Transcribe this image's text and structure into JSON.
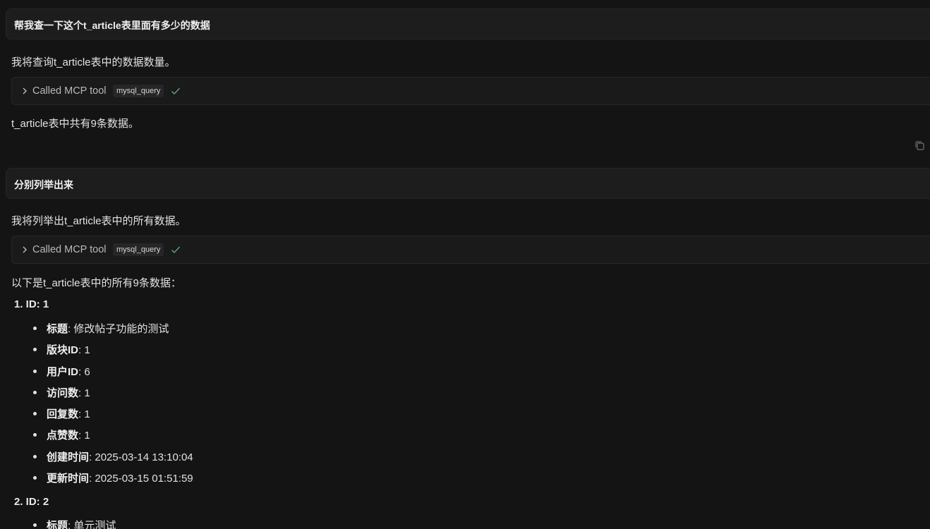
{
  "conversation": {
    "turn1": {
      "user": "帮我查一下这个t_article表里面有多少的数据",
      "assistant_intro": "我将查询t_article表中的数据数量。",
      "tool_call": {
        "label": "Called MCP tool",
        "tool_name": "mysql_query",
        "status": "success"
      },
      "assistant_result": "t_article表中共有9条数据。"
    },
    "turn2": {
      "user": "分别列举出来",
      "assistant_intro": "我将列举出t_article表中的所有数据。",
      "tool_call": {
        "label": "Called MCP tool",
        "tool_name": "mysql_query",
        "status": "success"
      },
      "assistant_result": "以下是t_article表中的所有9条数据："
    }
  },
  "records": [
    {
      "heading": "1. ID: 1",
      "fields": [
        {
          "key": "标题",
          "value": ": 修改帖子功能的测试"
        },
        {
          "key": "版块ID",
          "value": ": 1"
        },
        {
          "key": "用户ID",
          "value": ": 6"
        },
        {
          "key": "访问数",
          "value": ": 1"
        },
        {
          "key": "回复数",
          "value": ": 1"
        },
        {
          "key": "点赞数",
          "value": ": 1"
        },
        {
          "key": "创建时间",
          "value": ": 2025-03-14 13:10:04"
        },
        {
          "key": "更新时间",
          "value": ": 2025-03-15 01:51:59"
        }
      ]
    },
    {
      "heading": "2. ID: 2",
      "fields": [
        {
          "key": "标题",
          "value": ": 单元测试"
        }
      ]
    }
  ],
  "icons": {
    "chevron": "chevron-right-icon",
    "check": "check-icon",
    "copy": "copy-icon"
  },
  "colors": {
    "background": "#141414",
    "user_bubble": "#1d1d1d",
    "check_green": "#5fa86b"
  }
}
